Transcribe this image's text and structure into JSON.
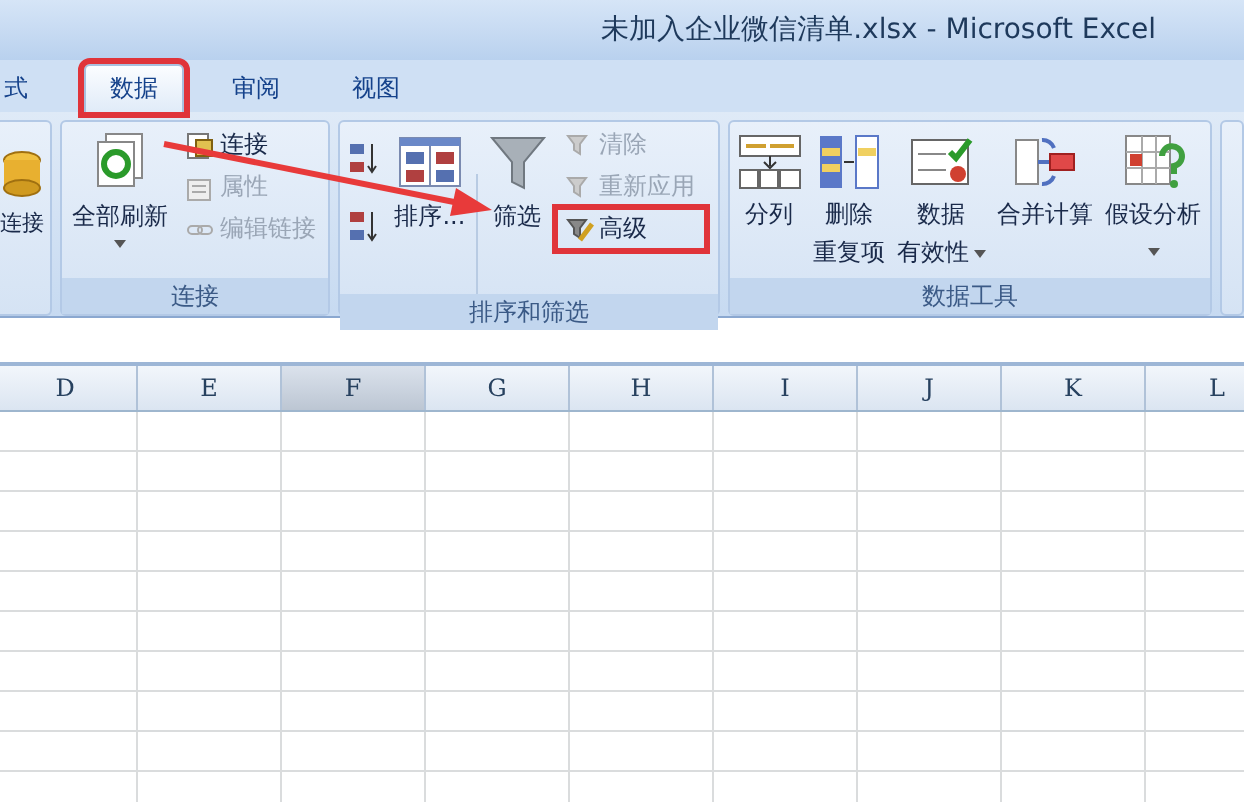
{
  "window": {
    "title": "未加入企业微信清单.xlsx - Microsoft Excel"
  },
  "tabs": [
    {
      "label": "式",
      "selected": false,
      "annotated": false
    },
    {
      "label": "数据",
      "selected": true,
      "annotated": true
    },
    {
      "label": "审阅",
      "selected": false,
      "annotated": false
    },
    {
      "label": "视图",
      "selected": false,
      "annotated": false
    }
  ],
  "ribbon": {
    "groups": [
      {
        "items": [
          {
            "lines": [
              "连接"
            ]
          }
        ]
      },
      {
        "label": "连接",
        "items": [
          {
            "lines": [
              "全部刷新"
            ],
            "dropdown": true
          },
          {
            "lines": [
              "连接"
            ],
            "disabled": false
          },
          {
            "lines": [
              "属性"
            ],
            "disabled": true
          },
          {
            "lines": [
              "编辑链接"
            ],
            "disabled": true
          }
        ]
      },
      {
        "label": "排序和筛选",
        "items": [
          {
            "lines": [
              "排序..."
            ]
          },
          {
            "lines": [
              "筛选"
            ]
          },
          {
            "lines": [
              "清除"
            ],
            "disabled": true
          },
          {
            "lines": [
              "重新应用"
            ],
            "disabled": true
          },
          {
            "lines": [
              "高级"
            ],
            "disabled": false,
            "annotated": true
          }
        ]
      },
      {
        "label": "数据工具",
        "items": [
          {
            "lines": [
              "分列"
            ],
            "dropdown": false
          },
          {
            "lines": [
              "删除",
              "重复项"
            ],
            "dropdown": false
          },
          {
            "lines": [
              "数据",
              "有效性"
            ],
            "dropdown": true
          },
          {
            "lines": [
              "合并计算"
            ],
            "dropdown": false
          },
          {
            "lines": [
              "假设分析"
            ],
            "dropdown": true
          }
        ]
      }
    ]
  },
  "columns": [
    {
      "label": "D",
      "selected": false
    },
    {
      "label": "E",
      "selected": false
    },
    {
      "label": "F",
      "selected": true
    },
    {
      "label": "G",
      "selected": false
    },
    {
      "label": "H",
      "selected": false
    },
    {
      "label": "I",
      "selected": false
    },
    {
      "label": "J",
      "selected": false
    },
    {
      "label": "K",
      "selected": false
    },
    {
      "label": "L",
      "selected": false
    }
  ]
}
